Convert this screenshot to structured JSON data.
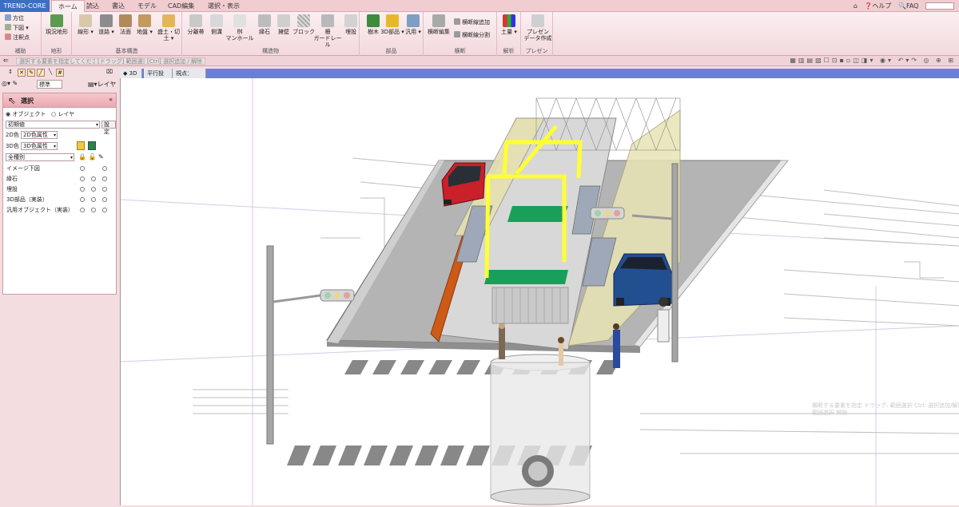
{
  "tabs": {
    "app": "TREND-CORE",
    "items": [
      "ホーム",
      "読込",
      "書込",
      "モデル",
      "CAD編集",
      "選択・表示"
    ],
    "help": "ヘルプ",
    "faq": "FAQ"
  },
  "ribbon": {
    "assist": {
      "items": [
        "方位",
        "下図",
        "注釈点"
      ],
      "label": "補助"
    },
    "terrain": {
      "button": "現況地形",
      "label": "地形"
    },
    "basic": {
      "buttons": [
        "線形",
        "道路",
        "法面",
        "地盤",
        "盛土・切土"
      ],
      "label": "基本構造"
    },
    "structures": {
      "buttons": [
        "分離帯",
        "側溝",
        "桝\nマンホール",
        "縁石",
        "擁壁",
        "ブロック",
        "柵\nガードレール",
        "埋設"
      ],
      "label": "構造物"
    },
    "parts": {
      "buttons": [
        "樹木",
        "3D部品",
        "汎用"
      ],
      "label": "部品"
    },
    "cross": {
      "buttons": [
        "横断編集"
      ],
      "small": [
        "横断線追加",
        "横断線分割"
      ],
      "label": "横断"
    },
    "analysis": {
      "buttons": [
        "土量"
      ],
      "label": "解析"
    },
    "presen": {
      "buttons": [
        "プレゼン\nデータ作成"
      ],
      "label": "プレゼン"
    }
  },
  "infobar": {
    "messages": [
      "選択する要素を指定してください",
      "[ドラッグ] 範囲選択",
      "[Ctrl] 選択追加 / 解除"
    ]
  },
  "left": {
    "std_select": "標準",
    "layer_btn": "レイヤ",
    "panel_title": "選択",
    "radio_object": "オブジェクト",
    "radio_layer": "レイヤ",
    "preset": "初期値",
    "settings_btn": "設定",
    "color2d_label": "2D色",
    "color2d_value": "2D色属性",
    "color3d_label": "3D色",
    "color3d_value": "3D色属性",
    "kind": "全種別",
    "rows": [
      "イメージ下図",
      "縁石",
      "埋設",
      "3D部品（実装）",
      "汎用オブジェクト（実装）"
    ]
  },
  "viewport": {
    "tab_3d": "3D",
    "projection": "平行投影",
    "viewpoint": "視点：Home",
    "ghost_text": [
      "横断する要素を指定 ドラッグ: 範囲選択 Ctrl: 選択追加/解除",
      "範囲選択 解除"
    ]
  },
  "colors": {
    "accent": "#3b6fc0",
    "ribbon": "#f3d9dd",
    "road": "#b4b4b4",
    "yellow_frame": "#ffff33",
    "green_mat": "#18a05a"
  }
}
